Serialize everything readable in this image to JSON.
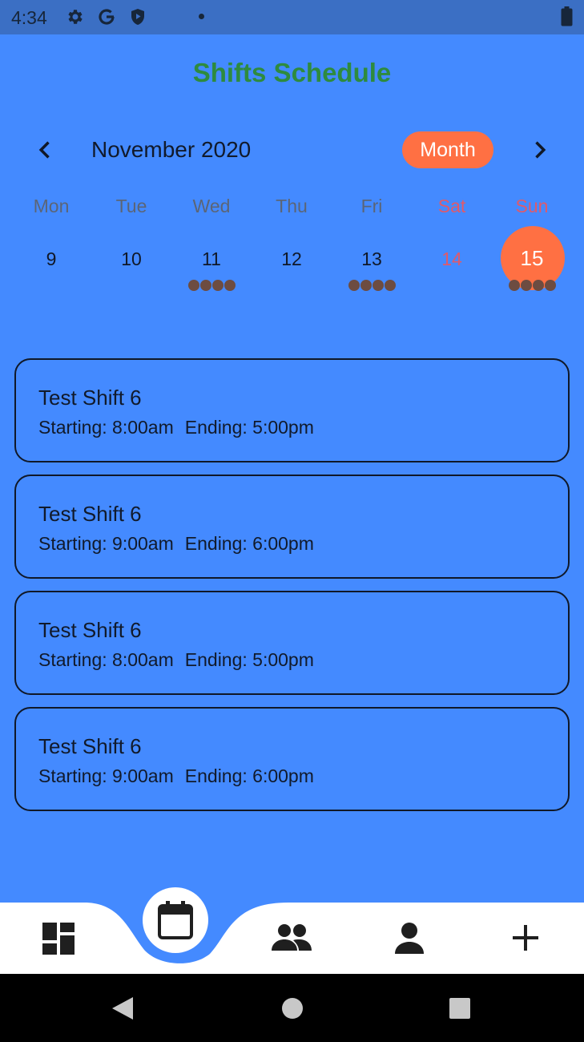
{
  "status_bar": {
    "time": "4:34",
    "icons": [
      "gear-icon",
      "google-icon",
      "play-protect-icon",
      "notification-dot-icon",
      "battery-icon"
    ]
  },
  "header": {
    "title": "Shifts Schedule"
  },
  "calendar": {
    "month_label": "November 2020",
    "format_button": "Month",
    "weekdays": [
      "Mon",
      "Tue",
      "Wed",
      "Thu",
      "Fri",
      "Sat",
      "Sun"
    ],
    "days": [
      "9",
      "10",
      "11",
      "12",
      "13",
      "14",
      "15"
    ],
    "selected_day": "15",
    "event_markers": {
      "11": 4,
      "13": 4,
      "15": 4
    }
  },
  "shifts": [
    {
      "name": "Test Shift 6",
      "start": "Starting: 8:00am",
      "end": "Ending: 5:00pm"
    },
    {
      "name": "Test Shift 6",
      "start": "Starting: 9:00am",
      "end": "Ending: 6:00pm"
    },
    {
      "name": "Test Shift 6",
      "start": "Starting: 8:00am",
      "end": "Ending: 5:00pm"
    },
    {
      "name": "Test Shift 6",
      "start": "Starting: 9:00am",
      "end": "Ending: 6:00pm"
    }
  ],
  "bottom_nav": {
    "items": [
      "dashboard-icon",
      "calendar-icon",
      "people-icon",
      "person-icon",
      "add-icon"
    ],
    "active": "calendar-icon"
  },
  "colors": {
    "background": "#448aff",
    "title_green": "#2e8b3e",
    "accent_orange": "#ff7043",
    "weekend_red": "#e05a6a",
    "marker_brown": "#6d4c41"
  }
}
